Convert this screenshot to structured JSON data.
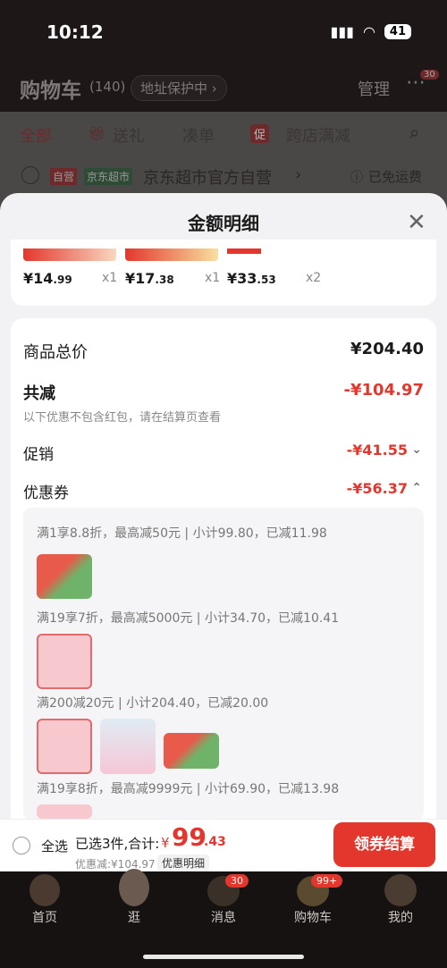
{
  "status": {
    "time": "10:12",
    "battery": "41"
  },
  "header": {
    "title": "购物车",
    "count": "(140)",
    "address_protect": "地址保护中 ›",
    "manage": "管理",
    "more_badge": "30"
  },
  "tabs": [
    {
      "label": "全部"
    },
    {
      "label": "送礼"
    },
    {
      "label": "凑单"
    },
    {
      "label": "跨店满减"
    }
  ],
  "tab_promo_tag": "促",
  "store": {
    "tag1": "自营",
    "tag2": "京东超市",
    "name": "京东超市官方自营",
    "arrow": "›",
    "shipping": "已免运费"
  },
  "sheet": {
    "title": "金额明细",
    "close": "✕"
  },
  "items": [
    {
      "price_main": "¥14",
      "price_dec": ".99",
      "qty": "x1"
    },
    {
      "price_main": "¥17",
      "price_dec": ".38",
      "qty": "x1"
    },
    {
      "price_main": "¥33",
      "price_dec": ".53",
      "qty": "x2"
    }
  ],
  "summary": {
    "total_label": "商品总价",
    "total_value": "¥204.40",
    "discount_label": "共减",
    "discount_value": "-¥104.97",
    "discount_note": "以下优惠不包含红包，请在结算页查看",
    "promo_label": "促销",
    "promo_value": "-¥41.55",
    "coupon_label": "优惠券",
    "coupon_value": "-¥56.37"
  },
  "coupon_rows": [
    "满1享8.8折，最高减50元 | 小计99.80，已减11.98",
    "满19享7折，最高减5000元 | 小计34.70，已减10.41",
    "满200减20元 | 小计204.40，已减20.00",
    "满19享8折，最高减9999元 | 小计69.90，已减13.98"
  ],
  "checkout": {
    "select_all": "全选",
    "selected": "已选3件,合计:",
    "currency": "¥",
    "amount_main": "99",
    "amount_dec": ".43",
    "discount_line": "优惠减:¥104.97",
    "detail_tag": "优惠明细",
    "button": "领券结算"
  },
  "nav": [
    {
      "label": "首页"
    },
    {
      "label": "逛"
    },
    {
      "label": "消息",
      "badge": "30"
    },
    {
      "label": "购物车",
      "badge": "99+"
    },
    {
      "label": "我的"
    }
  ],
  "colors": {
    "accent": "#e3372d",
    "sheet_bg": "#f2f2f4"
  }
}
